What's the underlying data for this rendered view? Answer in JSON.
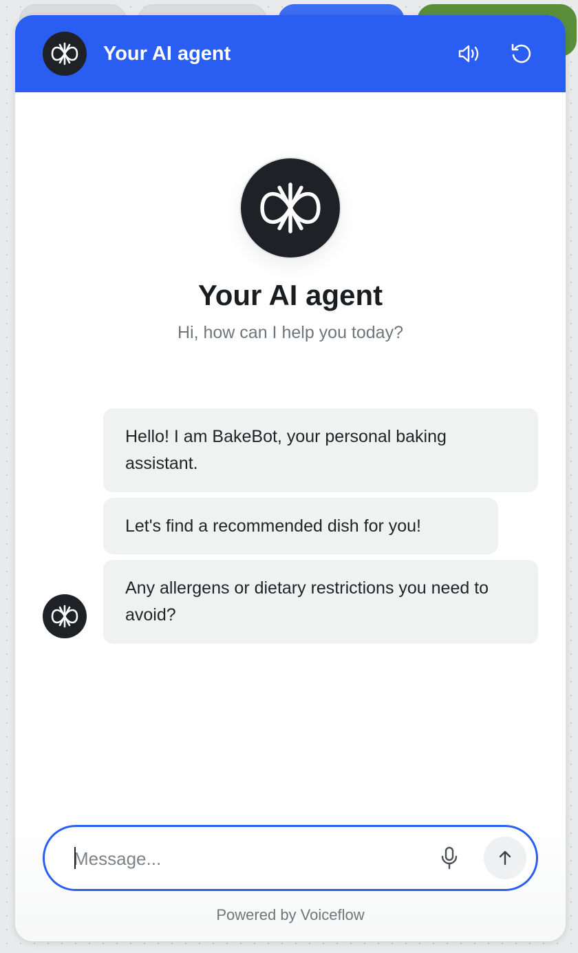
{
  "header": {
    "title": "Your AI agent",
    "speaker_icon": "speaker-icon",
    "reset_icon": "reset-icon",
    "background_color": "#2a5ef2"
  },
  "intro": {
    "title": "Your AI agent",
    "subtitle": "Hi, how can I help you today?"
  },
  "messages": [
    {
      "text": "Hello! I am BakeBot, your personal baking assistant."
    },
    {
      "text": "Let's find a recommended dish for you!"
    },
    {
      "text": "Any allergens or dietary restrictions you need to avoid?"
    }
  ],
  "composer": {
    "placeholder": "Message...",
    "value": "",
    "mic_icon": "microphone-icon",
    "send_icon": "arrow-up-icon"
  },
  "footer": {
    "text": "Powered by Voiceflow"
  },
  "colors": {
    "accent": "#2a5ef2",
    "avatar_bg": "#1e2226",
    "bubble_bg": "#f0f2f2"
  }
}
